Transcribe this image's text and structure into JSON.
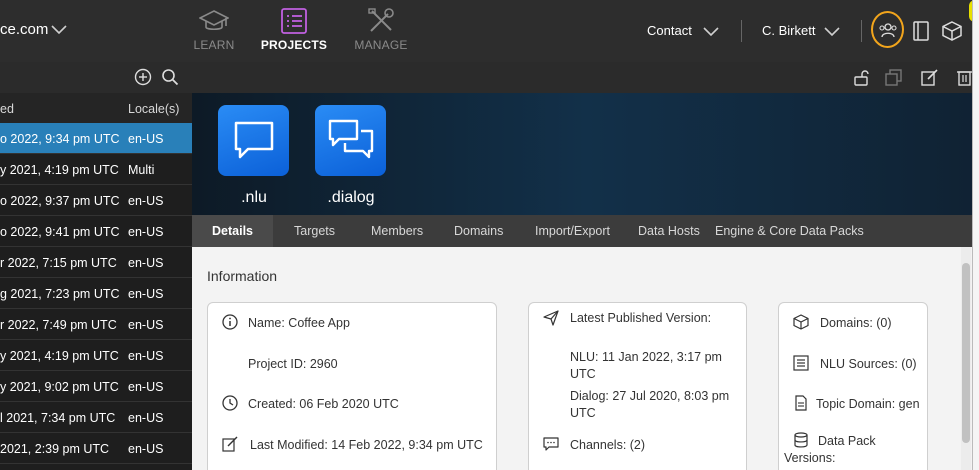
{
  "topbar": {
    "brand": "ce.com",
    "nav": [
      {
        "label": "LEARN",
        "icon": "graduation-cap-icon"
      },
      {
        "label": "PROJECTS",
        "icon": "list-icon"
      },
      {
        "label": "MANAGE",
        "icon": "tools-icon"
      }
    ],
    "contact": "Contact",
    "user": "C. Birkett",
    "accent": "#f2a51c"
  },
  "sidebar": {
    "headers": {
      "modified": "ed",
      "locale": "Locale(s)"
    },
    "rows": [
      {
        "date": "o 2022, 9:34 pm UTC",
        "locale": "en-US",
        "selected": true
      },
      {
        "date": "y 2021, 4:19 pm UTC",
        "locale": "Multi"
      },
      {
        "date": "o 2022, 9:37 pm UTC",
        "locale": "en-US"
      },
      {
        "date": "o 2022, 9:41 pm UTC",
        "locale": "en-US"
      },
      {
        "date": "r 2022, 7:15 pm UTC",
        "locale": "en-US"
      },
      {
        "date": "g 2021, 7:23 pm UTC",
        "locale": "en-US"
      },
      {
        "date": "r 2022, 7:49 pm UTC",
        "locale": "en-US"
      },
      {
        "date": "y 2021, 4:19 pm UTC",
        "locale": "en-US"
      },
      {
        "date": "y 2021, 9:02 pm UTC",
        "locale": "en-US"
      },
      {
        "date": "l 2021, 7:34 pm UTC",
        "locale": "en-US"
      },
      {
        "date": "2021, 2:39 pm UTC",
        "locale": "en-US"
      }
    ],
    "selected_color": "#2980b9"
  },
  "hero": {
    "tiles": [
      ".nlu",
      ".dialog"
    ]
  },
  "tabs": [
    "Details",
    "Targets",
    "Members",
    "Domains",
    "Import/Export",
    "Data Hosts",
    "Engine & Core Data Packs"
  ],
  "content": {
    "title": "Information",
    "card1": {
      "name": "Name: Coffee App",
      "project_id": "Project ID: 2960",
      "created": "Created: 06 Feb 2020 UTC",
      "modified": "Last Modified: 14 Feb 2022, 9:34 pm UTC"
    },
    "card2": {
      "published": "Latest Published Version:",
      "nlu_1": "NLU: 11 Jan 2022, 3:17 pm",
      "nlu_2": "UTC",
      "dialog_1": "Dialog: 27 Jul 2020, 8:03 pm",
      "dialog_2": "UTC",
      "channels": "Channels:  (2)"
    },
    "card3": {
      "domains": "Domains: (0)",
      "nlu_sources": "NLU Sources: (0)",
      "topic_domain": "Topic Domain: gen",
      "data_pack": "Data Pack",
      "versions": "Versions:"
    }
  }
}
